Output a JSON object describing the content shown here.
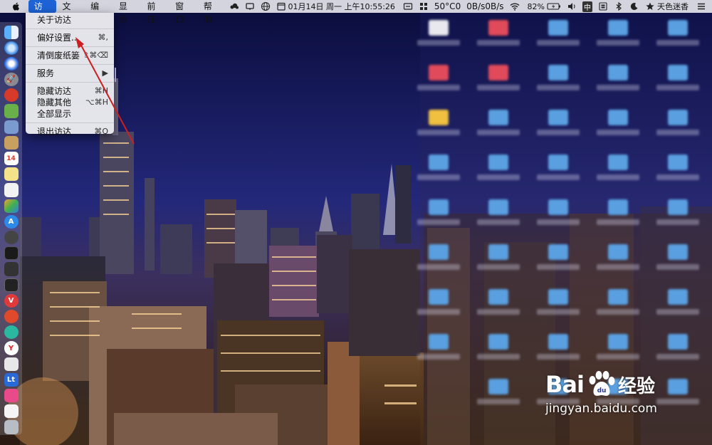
{
  "menubar": {
    "app_menus": [
      "访达",
      "文件",
      "编辑",
      "显示",
      "前往",
      "窗口",
      "帮助"
    ],
    "active_menu_index": 0,
    "tray": {
      "temperature": "50°C",
      "temperature_sub": "0",
      "net_up": "0B/s",
      "net_down": "0B/s",
      "datetime": "01月14日 周一 上午10:55:26",
      "battery": "82%",
      "input_method": "中",
      "user_name": "天色迷香"
    }
  },
  "dropdown": {
    "items": [
      {
        "label": "关于访达",
        "shortcut": ""
      },
      {
        "label": "偏好设置...",
        "shortcut": "⌘,"
      },
      {
        "label": "清倒废纸篓",
        "shortcut": "⇧⌘⌫"
      },
      {
        "label": "服务",
        "shortcut": "▶"
      },
      {
        "label": "隐藏访达",
        "shortcut": "⌘H"
      },
      {
        "label": "隐藏其他",
        "shortcut": "⌥⌘H"
      },
      {
        "label": "全部显示",
        "shortcut": ""
      },
      {
        "label": "退出访达",
        "shortcut": "⌘Q"
      }
    ]
  },
  "dock": {
    "icons": [
      "finder-icon",
      "safari-icon",
      "compass-icon",
      "launchpad-icon",
      "calendar-red-icon",
      "android-icon",
      "preview-icon",
      "package-icon",
      "calendar-icon",
      "notes-icon",
      "textedit-icon",
      "photos-icon",
      "appstore-icon",
      "chrome-like-icon",
      "activity-icon",
      "terminal-dark-icon",
      "terminal-icon",
      "vivaldi-icon",
      "weibo-icon",
      "wechat-icon",
      "yandex-icon",
      "editor-icon",
      "lt-icon",
      "folder-pink-icon",
      "document-icon",
      "trash-icon"
    ],
    "day_number": "14"
  },
  "watermark": {
    "brand_latin": "Bai",
    "brand_cn": "经验",
    "url": "jingyan.baidu.com"
  },
  "colors": {
    "menu_highlight": "#1e63d6",
    "annotation_arrow": "#cc1f1f"
  }
}
